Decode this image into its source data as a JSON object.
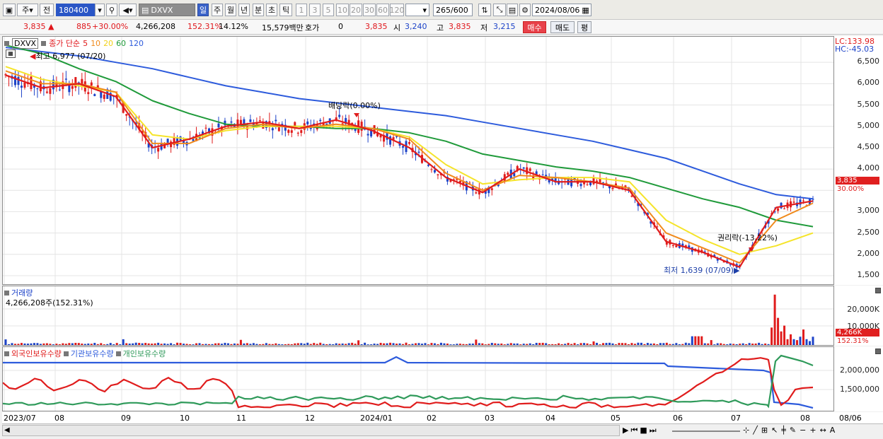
{
  "toolbar": {
    "market": "주",
    "mode": "전",
    "code": "180400",
    "name": "DXVX",
    "periods": [
      "일",
      "주",
      "월",
      "년",
      "분",
      "초",
      "틱"
    ],
    "minutes": [
      "1",
      "3",
      "5",
      "10",
      "20",
      "30",
      "60",
      "120"
    ],
    "count": "265",
    "max": "/600",
    "date": "2024/08/06"
  },
  "quote": {
    "price": "3,835",
    "change": "885",
    "rate": "+30.00%",
    "volume": "4,266,208",
    "vol_rate": "152.31%",
    "turnover": "14.12%",
    "amount": "15,579백만",
    "hoga_label": "호가",
    "hoga": "0",
    "ask": "3,835",
    "open_label": "시",
    "open": "3,240",
    "high_label": "고",
    "high": "3,835",
    "low_label": "저",
    "low": "3,215",
    "buy": "매수",
    "sell": "매도",
    "avg": "평"
  },
  "price_panel": {
    "symbol": "DXVX",
    "legend_prefix": "종가 단순",
    "ma_labels": [
      "5",
      "10",
      "20",
      "60",
      "120"
    ],
    "ma_colors": [
      "#e01c1c",
      "#f08a1c",
      "#f5e42a",
      "#1f9a3a",
      "#2d5bdc"
    ],
    "high_note": "최고 6,977 (07/20)",
    "low_note": "최저 1,639 (07/09)",
    "ex_div": "배당락(0.00%)",
    "ex_right": "권리락(-13.22%)",
    "lc": "LC:133.98",
    "hc": "HC:-45.03",
    "y_ticks": [
      "6,500",
      "6,000",
      "5,500",
      "5,000",
      "4,500",
      "4,000",
      "3,500",
      "3,000",
      "2,500",
      "2,000",
      "1,500"
    ],
    "cur_price": "3,835",
    "cur_rate": "30.00%"
  },
  "volume_panel": {
    "title": "거래량",
    "value": "4,266,208주(152.31%)",
    "y_ticks": [
      "20,000K",
      "10,000K"
    ],
    "cur": "4,266K",
    "cur_rate": "152.31%"
  },
  "holders_panel": {
    "labels": [
      "외국인보유수량",
      "기관보유수량",
      "개인보유수량"
    ],
    "colors": [
      "#e01c1c",
      "#2d5bdc",
      "#2f9a5a"
    ],
    "y_ticks": [
      "2,000,000",
      "1,500,000"
    ]
  },
  "x_axis": {
    "labels": [
      "2023/07",
      "08",
      "09",
      "10",
      "11",
      "12",
      "2024/01",
      "02",
      "03",
      "04",
      "05",
      "06",
      "07",
      "08"
    ],
    "right": "08/06"
  },
  "chart_data": {
    "type": "candlestick",
    "title": "",
    "price_range": [
      1400,
      7000
    ],
    "volume_range": [
      0,
      27000
    ],
    "series": [
      {
        "name": "5",
        "values": [
          6200,
          5900,
          6000,
          5700,
          4500,
          4700,
          5000,
          5100,
          4950,
          5150,
          4900,
          4500,
          3800,
          3450,
          4000,
          3700,
          3700,
          3500,
          2300,
          2050,
          1700,
          3100,
          3250
        ]
      },
      {
        "name": "10",
        "values": [
          6300,
          6000,
          6000,
          5800,
          4600,
          4600,
          4950,
          5050,
          4950,
          5050,
          4950,
          4700,
          3900,
          3500,
          3850,
          3800,
          3700,
          3550,
          2500,
          2150,
          1800,
          2800,
          3200
        ]
      },
      {
        "name": "20",
        "values": [
          6400,
          6100,
          5950,
          5800,
          4800,
          4700,
          4900,
          5000,
          5000,
          5000,
          4950,
          4750,
          4100,
          3650,
          3750,
          3800,
          3800,
          3700,
          2800,
          2350,
          2000,
          2200,
          2500
        ]
      },
      {
        "name": "60",
        "values": [
          6900,
          6700,
          6350,
          6050,
          5600,
          5300,
          5050,
          5000,
          5000,
          4950,
          4950,
          4850,
          4650,
          4350,
          4200,
          4050,
          3950,
          3800,
          3550,
          3300,
          3100,
          2800,
          2650
        ]
      },
      {
        "name": "120",
        "values": [
          6850,
          6750,
          6650,
          6500,
          6350,
          6150,
          5950,
          5800,
          5650,
          5550,
          5450,
          5350,
          5250,
          5100,
          4950,
          4800,
          4650,
          4450,
          4250,
          3950,
          3650,
          3400,
          3300
        ]
      }
    ]
  }
}
